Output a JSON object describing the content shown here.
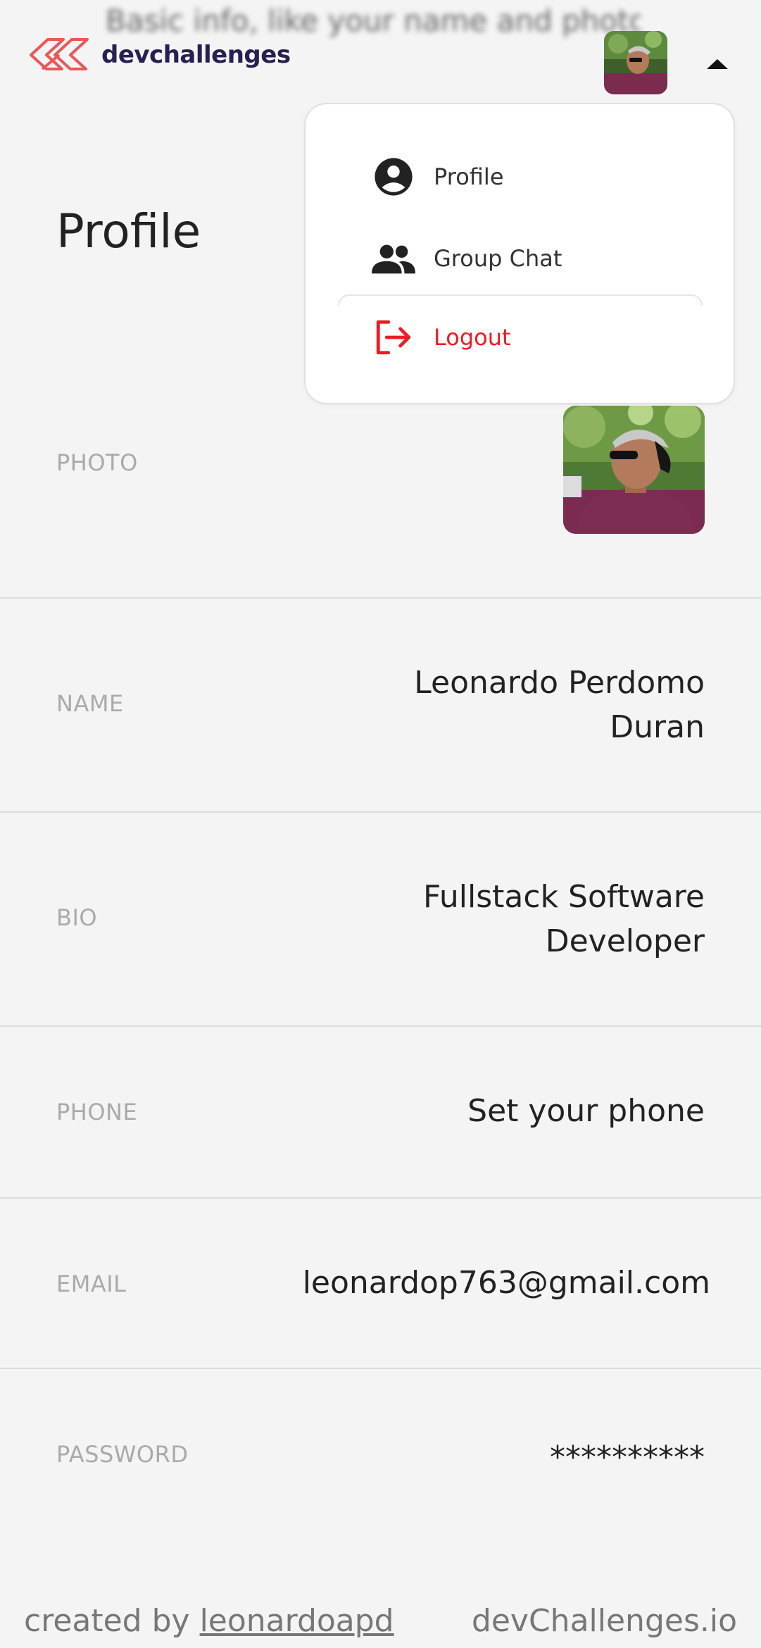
{
  "header": {
    "subtitle": "Basic info, like your name and photo",
    "logo_text": "devchallenges",
    "logo_icon": "devchallenges-logo-icon",
    "caret_icon": "caret-up-icon",
    "colors": {
      "logo_red": "#eb5757",
      "logo_text": "#282051"
    }
  },
  "dropdown": {
    "items": [
      {
        "label": "Profile",
        "icon": "account-circle-icon"
      },
      {
        "label": "Group Chat",
        "icon": "group-icon"
      },
      {
        "label": "Logout",
        "icon": "logout-icon"
      }
    ],
    "logout_color": "#eb1c24"
  },
  "page": {
    "title": "Profile"
  },
  "rows": {
    "photo": {
      "label": "PHOTO"
    },
    "name": {
      "label": "NAME",
      "value": "Leonardo Perdomo Duran"
    },
    "bio": {
      "label": "BIO",
      "value": "Fullstack Software Developer"
    },
    "phone": {
      "label": "PHONE",
      "value": "Set your phone"
    },
    "email": {
      "label": "EMAIL",
      "value": "leonardop763@gmail.com"
    },
    "password": {
      "label": "PASSWORD",
      "value": "**********"
    }
  },
  "footer": {
    "created_by": "created by",
    "author": "leonardoapd",
    "site": "devChallenges.io"
  }
}
